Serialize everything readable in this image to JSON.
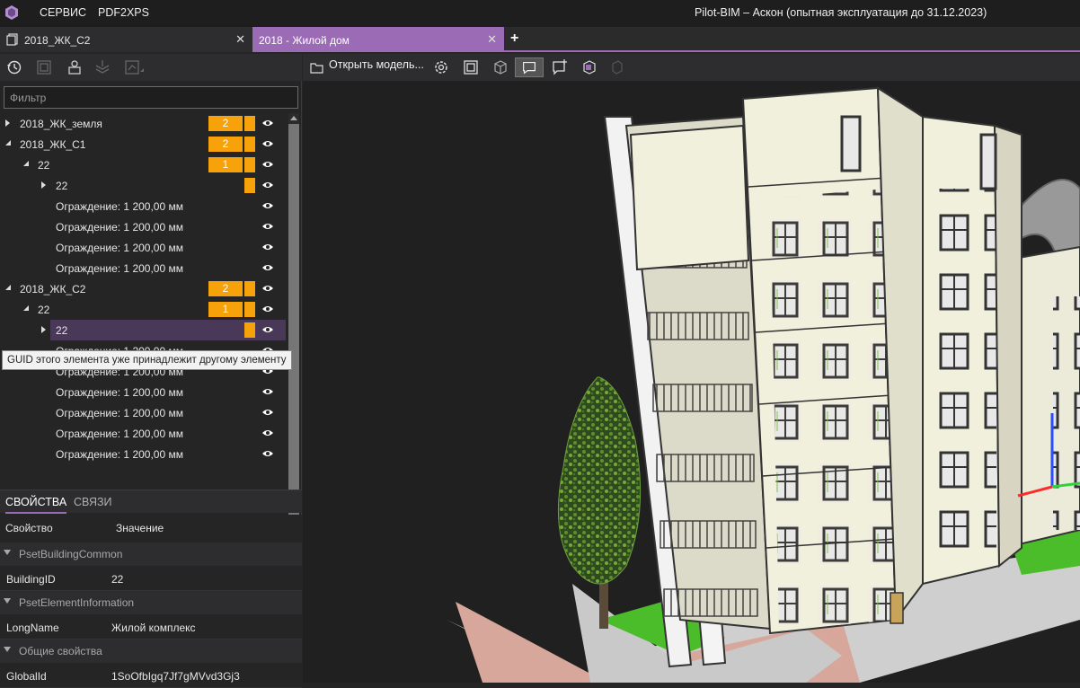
{
  "titlebar": {
    "menu": [
      "СЕРВИС",
      "PDF2XPS"
    ],
    "title": "Pilot-BIM – Аскон (опытная эксплуатация до 31.12.2023)"
  },
  "tabs": [
    {
      "label": "2018_ЖК_С2",
      "active": false
    },
    {
      "label": "2018 - Жилой дом",
      "active": true
    }
  ],
  "left_panel": {
    "filter_placeholder": "Фильтр",
    "tree": [
      {
        "label": "2018_ЖК_земля",
        "level": 0,
        "expand": "collapsed",
        "badge": "2",
        "mark": true
      },
      {
        "label": "2018_ЖК_С1",
        "level": 0,
        "expand": "expanded",
        "badge": "2",
        "mark": true
      },
      {
        "label": "22",
        "level": 1,
        "expand": "expanded",
        "badge": "1",
        "mark": true
      },
      {
        "label": "22",
        "level": 2,
        "expand": "collapsed",
        "badge": "",
        "mark": true
      },
      {
        "label": "Ограждение: 1 200,00 мм",
        "level": 3,
        "expand": "none",
        "badge": "",
        "mark": false
      },
      {
        "label": "Ограждение: 1 200,00 мм",
        "level": 3,
        "expand": "none",
        "badge": "",
        "mark": false
      },
      {
        "label": "Ограждение: 1 200,00 мм",
        "level": 3,
        "expand": "none",
        "badge": "",
        "mark": false
      },
      {
        "label": "Ограждение: 1 200,00 мм",
        "level": 3,
        "expand": "none",
        "badge": "",
        "mark": false
      },
      {
        "label": "2018_ЖК_С2",
        "level": 0,
        "expand": "expanded",
        "badge": "2",
        "mark": true
      },
      {
        "label": "22",
        "level": 1,
        "expand": "expanded",
        "badge": "1",
        "mark": true
      },
      {
        "label": "22",
        "level": 2,
        "expand": "collapsed",
        "badge": "",
        "mark": true,
        "selected": true
      },
      {
        "label": "Ограждение: 1 200,00 мм",
        "level": 3,
        "expand": "none",
        "badge": "",
        "mark": false
      },
      {
        "label": "Ограждение: 1 200,00 мм",
        "level": 3,
        "expand": "none",
        "badge": "",
        "mark": false
      },
      {
        "label": "Ограждение: 1 200,00 мм",
        "level": 3,
        "expand": "none",
        "badge": "",
        "mark": false
      },
      {
        "label": "Ограждение: 1 200,00 мм",
        "level": 3,
        "expand": "none",
        "badge": "",
        "mark": false
      },
      {
        "label": "Ограждение: 1 200,00 мм",
        "level": 3,
        "expand": "none",
        "badge": "",
        "mark": false
      },
      {
        "label": "Ограждение: 1 200,00 мм",
        "level": 3,
        "expand": "none",
        "badge": "",
        "mark": false
      }
    ],
    "tooltip": "GUID этого элемента уже принадлежит другому элементу",
    "props_tabs": [
      "СВОЙСТВА",
      "СВЯЗИ"
    ],
    "props_header": {
      "property": "Свойство",
      "value": "Значение"
    },
    "groups": [
      {
        "name": "PsetBuildingCommon",
        "rows": [
          {
            "key": "BuildingID",
            "value": "22"
          }
        ]
      },
      {
        "name": "PsetElementInformation",
        "rows": [
          {
            "key": "LongName",
            "value": "Жилой комплекс"
          }
        ]
      },
      {
        "name": "Общие свойства",
        "rows": [
          {
            "key": "GlobalId",
            "value": "1SoOfbIgq7Jf7gMVvd3Gj3"
          }
        ]
      }
    ]
  },
  "viewer_toolbar": {
    "open_model": "Открыть модель..."
  },
  "colors": {
    "accent": "#9b6bb5",
    "badge": "#f7a20a",
    "background": "#252526"
  }
}
